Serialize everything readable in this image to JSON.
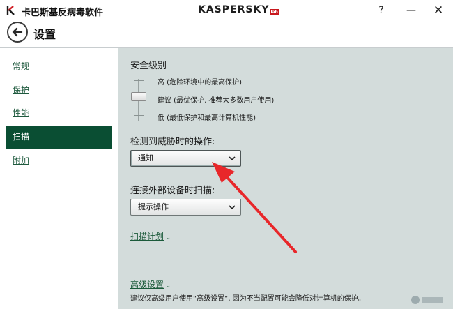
{
  "window": {
    "app_title": "卡巴斯基反病毒软件",
    "brand": "KASPERSKY",
    "brand_badge": "lab",
    "help_label": "?",
    "minimize_label": "—",
    "close_label": "✕"
  },
  "header": {
    "page_title": "设置"
  },
  "sidebar": {
    "items": [
      {
        "label": "常规",
        "active": false
      },
      {
        "label": "保护",
        "active": false
      },
      {
        "label": "性能",
        "active": false
      },
      {
        "label": "扫描",
        "active": true
      },
      {
        "label": "附加",
        "active": false
      }
    ]
  },
  "content": {
    "security_level_title": "安全级别",
    "levels": [
      "高 (危险环境中的最高保护)",
      "建议 (最优保护, 推荐大多数用户使用)",
      "低 (最低保护和最高计算机性能)"
    ],
    "selected_level": "建议 (最优保护, 推荐大多数用户使用)",
    "threat_action_title": "检测到威胁时的操作:",
    "threat_action_value": "通知",
    "external_device_title": "连接外部设备时扫描:",
    "external_device_value": "提示操作",
    "scan_schedule_link": "扫描计划",
    "advanced_link": "高级设置",
    "advanced_note": "建议仅高级用户使用“高级设置”, 因为不当配置可能会降低对计算机的保护。"
  },
  "colors": {
    "accent_green": "#0a4e33",
    "content_bg": "#d3dcdb",
    "annotation_arrow": "#e8272a"
  }
}
